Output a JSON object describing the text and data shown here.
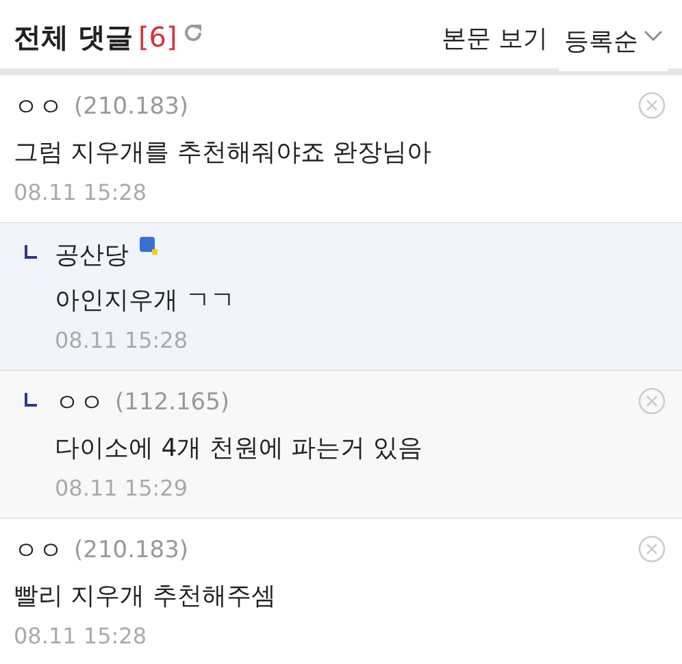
{
  "header": {
    "title": "전체 댓글",
    "count": "[6]",
    "view_post": "본문 보기",
    "sort": "등록순"
  },
  "comments": [
    {
      "kind": "comment",
      "author": "ㅇㅇ",
      "ip": "(210.183)",
      "text": "그럼 지우개를 추천해줘야죠 완장님아",
      "time": "08.11 15:28",
      "deletable": true,
      "member": false,
      "highlighted": false
    },
    {
      "kind": "reply",
      "author": "공산당",
      "text": "아인지우개 ㄱㄱ",
      "time": "08.11 15:28",
      "deletable": false,
      "member": true,
      "highlighted": true
    },
    {
      "kind": "reply",
      "author": "ㅇㅇ",
      "ip": "(112.165)",
      "text": "다이소에 4개 천원에 파는거 있음",
      "time": "08.11 15:29",
      "deletable": true,
      "member": false,
      "highlighted": false
    },
    {
      "kind": "comment",
      "author": "ㅇㅇ",
      "ip": "(210.183)",
      "text": "빨리 지우개 추천해주셈",
      "time": "08.11 15:28",
      "deletable": true,
      "member": false,
      "highlighted": false
    }
  ]
}
